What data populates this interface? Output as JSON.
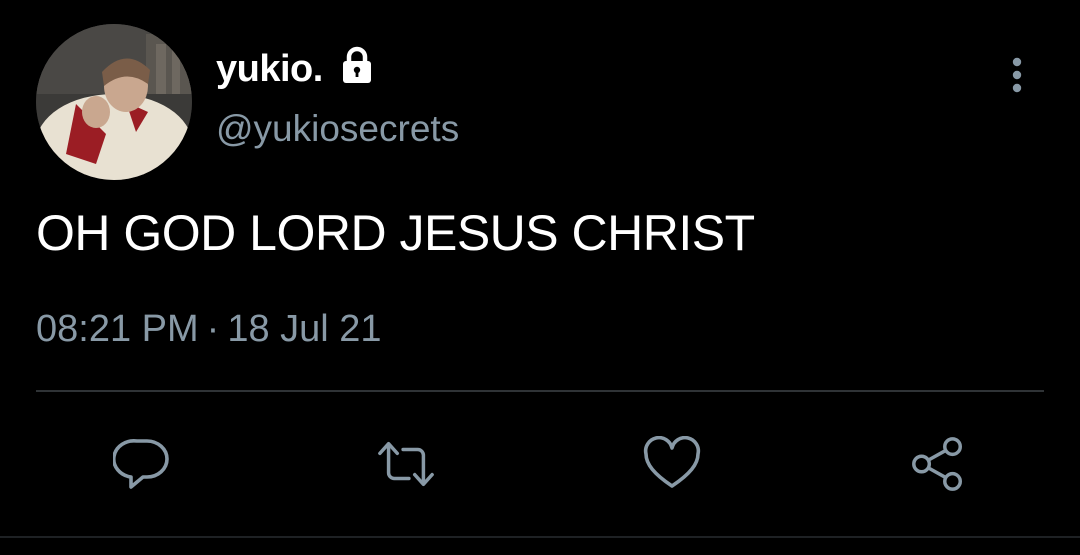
{
  "user": {
    "display_name": "yukio.",
    "handle": "@yukiosecrets",
    "protected_icon": "lock-icon",
    "avatar_icon": "profile-photo"
  },
  "tweet": {
    "text": "OH GOD LORD JESUS CHRIST",
    "time": "08:21 PM",
    "separator": "·",
    "date": "18 Jul 21"
  },
  "menu": {
    "icon": "more-vertical-icon"
  },
  "actions": [
    {
      "icon": "reply-icon"
    },
    {
      "icon": "retweet-icon"
    },
    {
      "icon": "like-icon"
    },
    {
      "icon": "share-icon"
    }
  ],
  "colors": {
    "background": "#000000",
    "text": "#ffffff",
    "muted": "#8899a6",
    "divider": "#2f3336"
  }
}
